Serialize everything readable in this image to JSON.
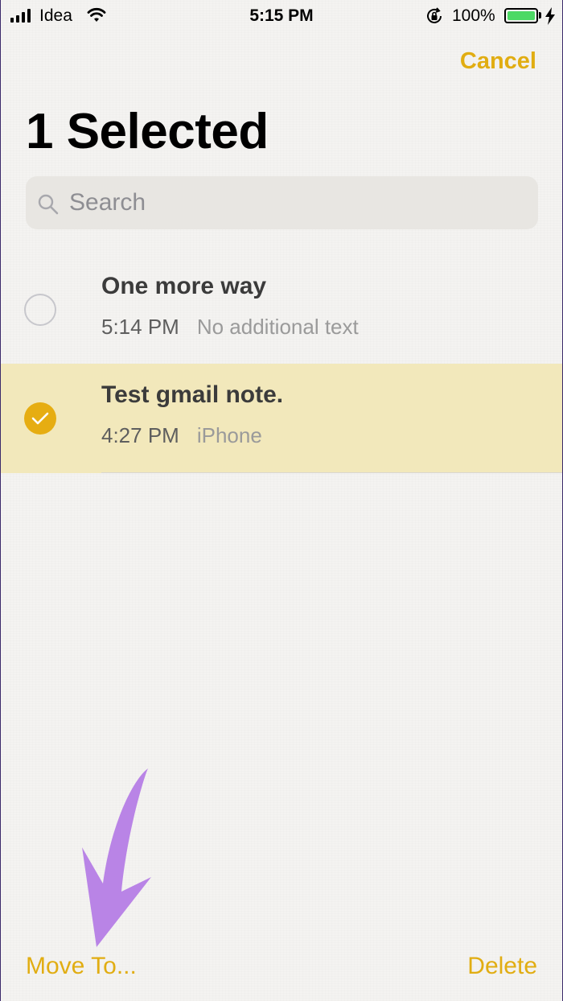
{
  "status_bar": {
    "carrier": "Idea",
    "time": "5:15 PM",
    "battery_percent": "100%",
    "battery_color": "#4cd964",
    "icons": [
      "signal-bars-icon",
      "wifi-icon",
      "rotation-lock-icon",
      "battery-icon",
      "charging-bolt-icon"
    ]
  },
  "header": {
    "cancel_label": "Cancel",
    "title": "1 Selected"
  },
  "search": {
    "placeholder": "Search",
    "value": "",
    "icon": "search-icon"
  },
  "notes": [
    {
      "title": "One more way",
      "time": "5:14 PM",
      "preview": "No additional text",
      "selected": false
    },
    {
      "title": "Test gmail note.",
      "time": "4:27 PM",
      "preview": "iPhone",
      "selected": true
    }
  ],
  "toolbar": {
    "move_label": "Move To...",
    "delete_label": "Delete"
  },
  "colors": {
    "accent": "#e1ad12",
    "selected_row": "#f2e8bb",
    "annotation_arrow": "#b984e6"
  }
}
